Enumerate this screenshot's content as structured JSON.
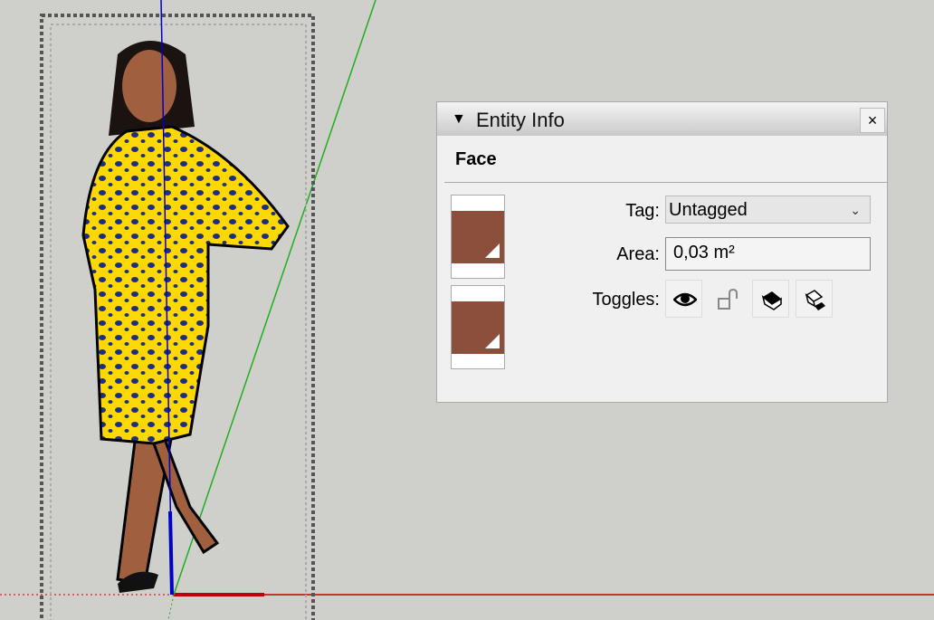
{
  "colors": {
    "background": "#cfd0cb",
    "axis_red": "#c00000",
    "axis_green": "#1fae1f",
    "axis_blue": "#0000c8",
    "material": "#8b4f3b",
    "dress": "#ffd800",
    "dots": "#1b2f86"
  },
  "panel": {
    "title": "Entity Info",
    "collapse_icon": "triangle-down",
    "close_label": "×",
    "entity_type": "Face",
    "tag_label": "Tag:",
    "tag_value": "Untagged",
    "area_label": "Area:",
    "area_value": "0,03 m²",
    "toggles_label": "Toggles:",
    "toggles": [
      "visible-eye-icon",
      "unlock-icon",
      "cast-shadows-icon",
      "receive-shadows-icon"
    ]
  }
}
